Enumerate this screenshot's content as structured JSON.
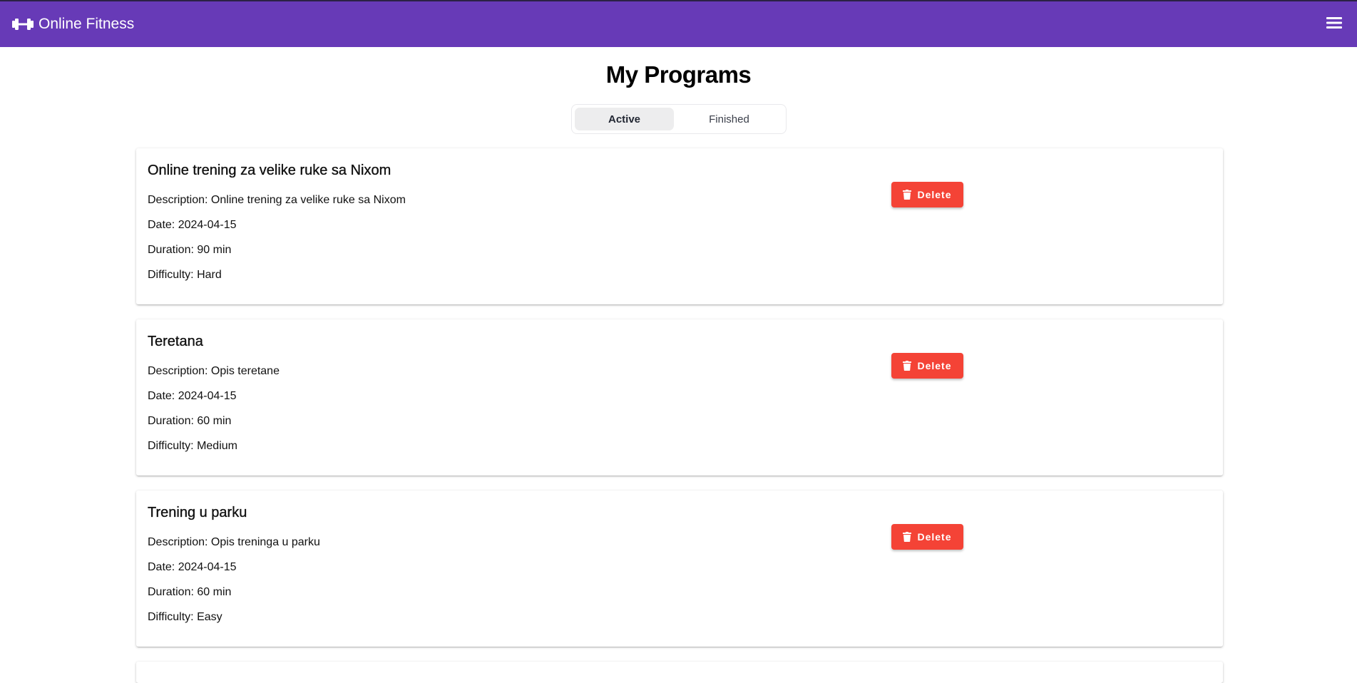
{
  "header": {
    "brand_title": "Online Fitness",
    "brand_icon": "dumbbell-icon",
    "menu_icon": "hamburger-menu-icon",
    "bar_color": "#673ab7"
  },
  "page": {
    "title": "My Programs"
  },
  "tabs": [
    {
      "label": "Active",
      "selected": true
    },
    {
      "label": "Finished",
      "selected": false
    }
  ],
  "labels": {
    "description": "Description: ",
    "date": "Date: ",
    "duration": "Duration: ",
    "difficulty": "Difficulty: "
  },
  "programs": [
    {
      "title": "Online trening za velike ruke sa Nixom",
      "description": "Online trening za velike ruke sa Nixom",
      "date": "2024-04-15",
      "duration": "90 min",
      "difficulty": "Hard",
      "delete_label": "Delete"
    },
    {
      "title": "Teretana",
      "description": "Opis teretane",
      "date": "2024-04-15",
      "duration": "60 min",
      "difficulty": "Medium",
      "delete_label": "Delete"
    },
    {
      "title": "Trening u parku",
      "description": "Opis treninga u parku",
      "date": "2024-04-15",
      "duration": "60 min",
      "difficulty": "Easy",
      "delete_label": "Delete"
    }
  ],
  "colors": {
    "accent": "#673ab7",
    "danger": "#f44336"
  }
}
